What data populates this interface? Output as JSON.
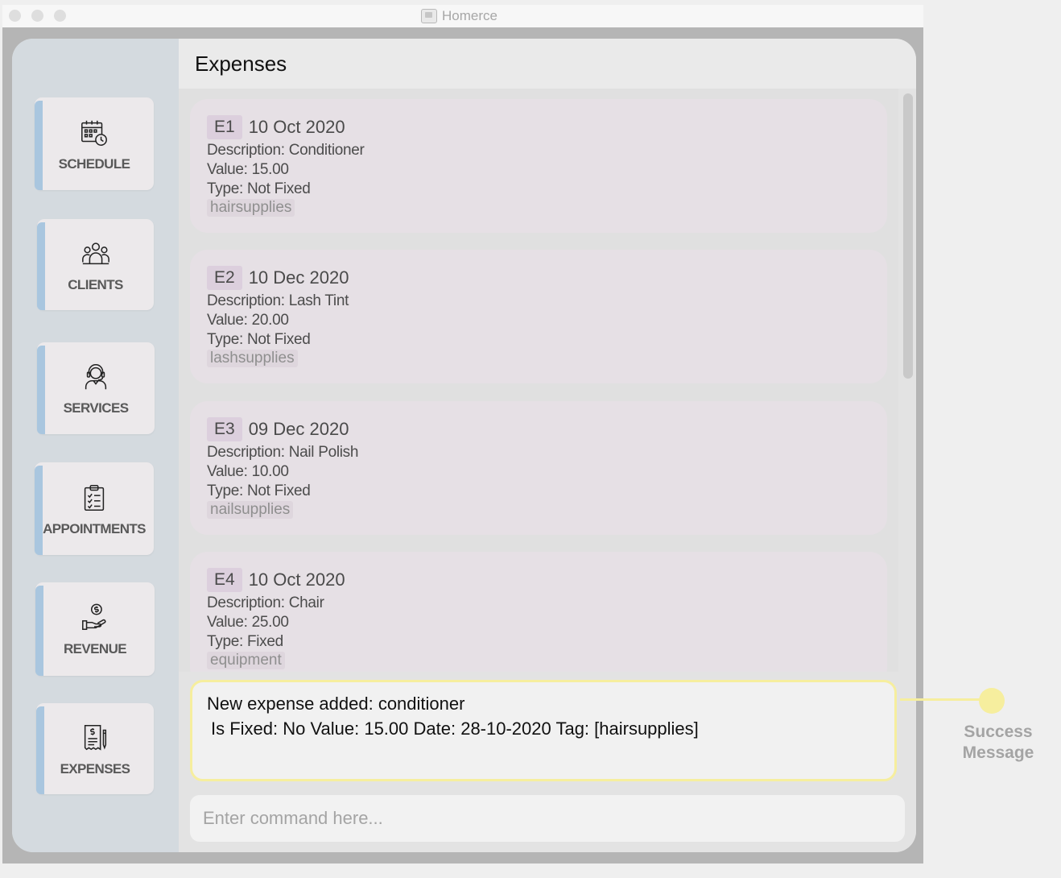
{
  "window": {
    "title": "Homerce"
  },
  "sidebar": {
    "items": [
      {
        "label": "SCHEDULE",
        "icon": "calendar-clock-icon"
      },
      {
        "label": "CLIENTS",
        "icon": "people-group-icon"
      },
      {
        "label": "SERVICES",
        "icon": "headset-person-icon"
      },
      {
        "label": "APPOINTMENTS",
        "icon": "clipboard-checklist-icon"
      },
      {
        "label": "REVENUE",
        "icon": "hand-coin-icon"
      },
      {
        "label": "EXPENSES",
        "icon": "invoice-pen-icon"
      }
    ]
  },
  "main": {
    "title": "Expenses",
    "expenses": [
      {
        "id": "E1",
        "date": "10 Oct 2020",
        "description": "Description: Conditioner",
        "value": "Value: 15.00",
        "type": "Type: Not Fixed",
        "tag": "hairsupplies"
      },
      {
        "id": "E2",
        "date": "10 Dec 2020",
        "description": "Description: Lash Tint",
        "value": "Value: 20.00",
        "type": "Type: Not Fixed",
        "tag": "lashsupplies"
      },
      {
        "id": "E3",
        "date": "09 Dec 2020",
        "description": "Description: Nail Polish",
        "value": "Value: 10.00",
        "type": "Type: Not Fixed",
        "tag": "nailsupplies"
      },
      {
        "id": "E4",
        "date": "10 Oct 2020",
        "description": "Description: Chair",
        "value": "Value: 25.00",
        "type": "Type: Fixed",
        "tag": "equipment"
      }
    ]
  },
  "result": {
    "line1": "New expense added: conditioner",
    "line2": "Is Fixed: No Value: 15.00 Date: 28-10-2020 Tag: [hairsupplies]"
  },
  "command": {
    "placeholder": "Enter command here..."
  },
  "annotation": {
    "line1": "Success",
    "line2": "Message",
    "color": "#f6ee9e"
  }
}
